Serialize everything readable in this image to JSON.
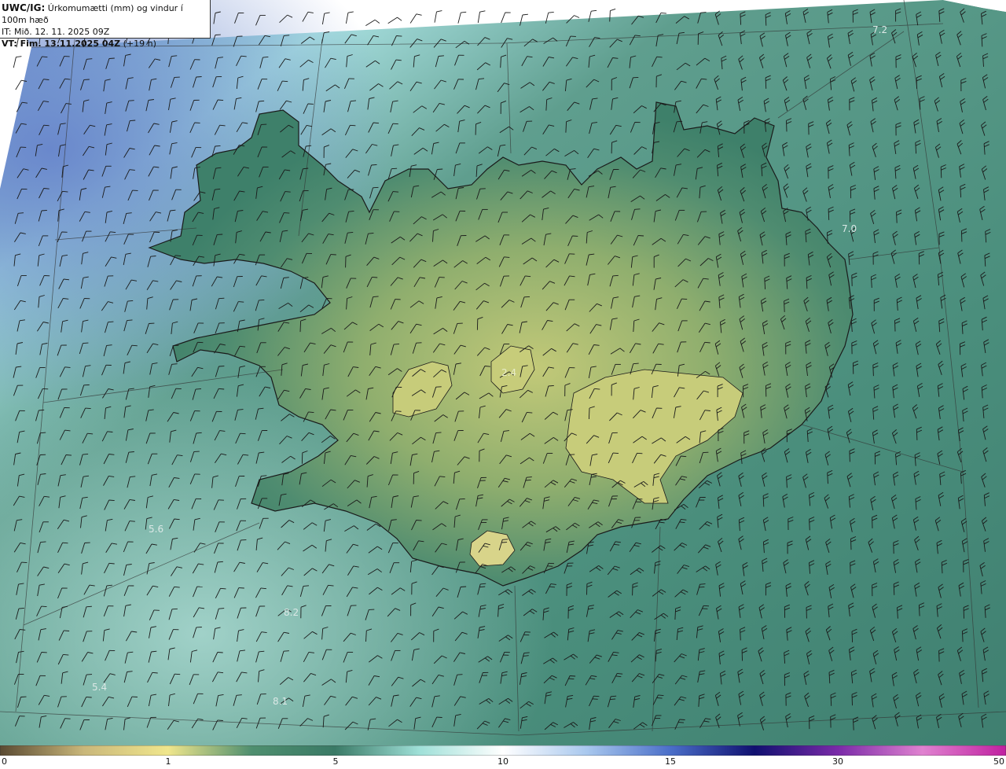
{
  "header": {
    "title_prefix": "UWC/IG:",
    "title_text": " Úrkomumætti (mm) og vindur í 100m hæð",
    "it_text": "IT: Mið. 12. 11. 2025 09Z",
    "vt_prefix": "VT: Fim. 13.11.2025 04Z",
    "vt_suffix": " (+19 h)"
  },
  "map_labels": [
    "7.2",
    "7.0",
    "2.4",
    "5.6",
    "8.2",
    "5.4",
    "8.1"
  ],
  "colorbar": {
    "ticks": [
      "0",
      "1",
      "5",
      "10",
      "15",
      "30",
      "50"
    ],
    "colors": [
      "#5a4a32",
      "#c9b77a",
      "#f0e68c",
      "#4f8f6f",
      "#3a7a66",
      "#9fe0d8",
      "#ffffff",
      "#a9c8ee",
      "#4a6ec8",
      "#101070",
      "#7a2aa8",
      "#e082d0",
      "#c020a0"
    ]
  },
  "colors": {
    "sea_shallow": "#5f9e8e",
    "sea_deep": "#3f7f70",
    "land_low": "#3e806a",
    "land_high": "#b9c67a",
    "nw_sky": "#6f8ed0"
  }
}
